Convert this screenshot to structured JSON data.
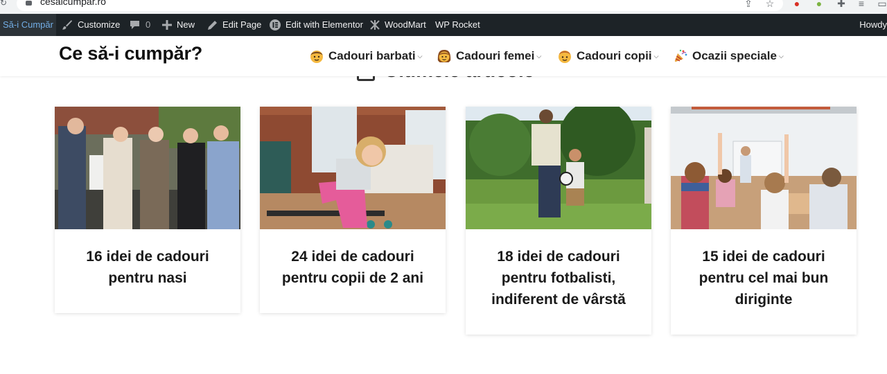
{
  "browser": {
    "url": "cesaicumpar.ro"
  },
  "admin_bar": {
    "site_name": "Să-i Cumpăr",
    "customize": "Customize",
    "comments_count": "0",
    "new": "New",
    "edit_page": "Edit Page",
    "edit_elementor": "Edit with Elementor",
    "woodmart": "WoodMart",
    "wp_rocket": "WP Rocket",
    "howdy": "Howdy"
  },
  "header": {
    "logo": "Ce să-i cumpăr?",
    "nav": [
      {
        "label": "Cadouri barbati",
        "icon": "man-emoji-icon"
      },
      {
        "label": "Cadouri femei",
        "icon": "woman-emoji-icon"
      },
      {
        "label": "Cadouri copii",
        "icon": "child-emoji-icon"
      },
      {
        "label": "Ocazii speciale",
        "icon": "party-popper-icon"
      }
    ]
  },
  "section": {
    "title": "Ultimele articole"
  },
  "articles": [
    {
      "title": "16 idei de cadouri pentru nasi"
    },
    {
      "title": "24 idei de cadouri pentru copii de 2 ani"
    },
    {
      "title": "18 idei de cadouri pentru fotbalisti, indiferent de vârstă"
    },
    {
      "title": "15 idei de cadouri pentru cel mai bun diriginte"
    }
  ],
  "colors": {
    "admin_bar_bg": "#1d2327",
    "admin_bar_site_link": "#72aee6",
    "text_dark": "#1a1a1a"
  }
}
